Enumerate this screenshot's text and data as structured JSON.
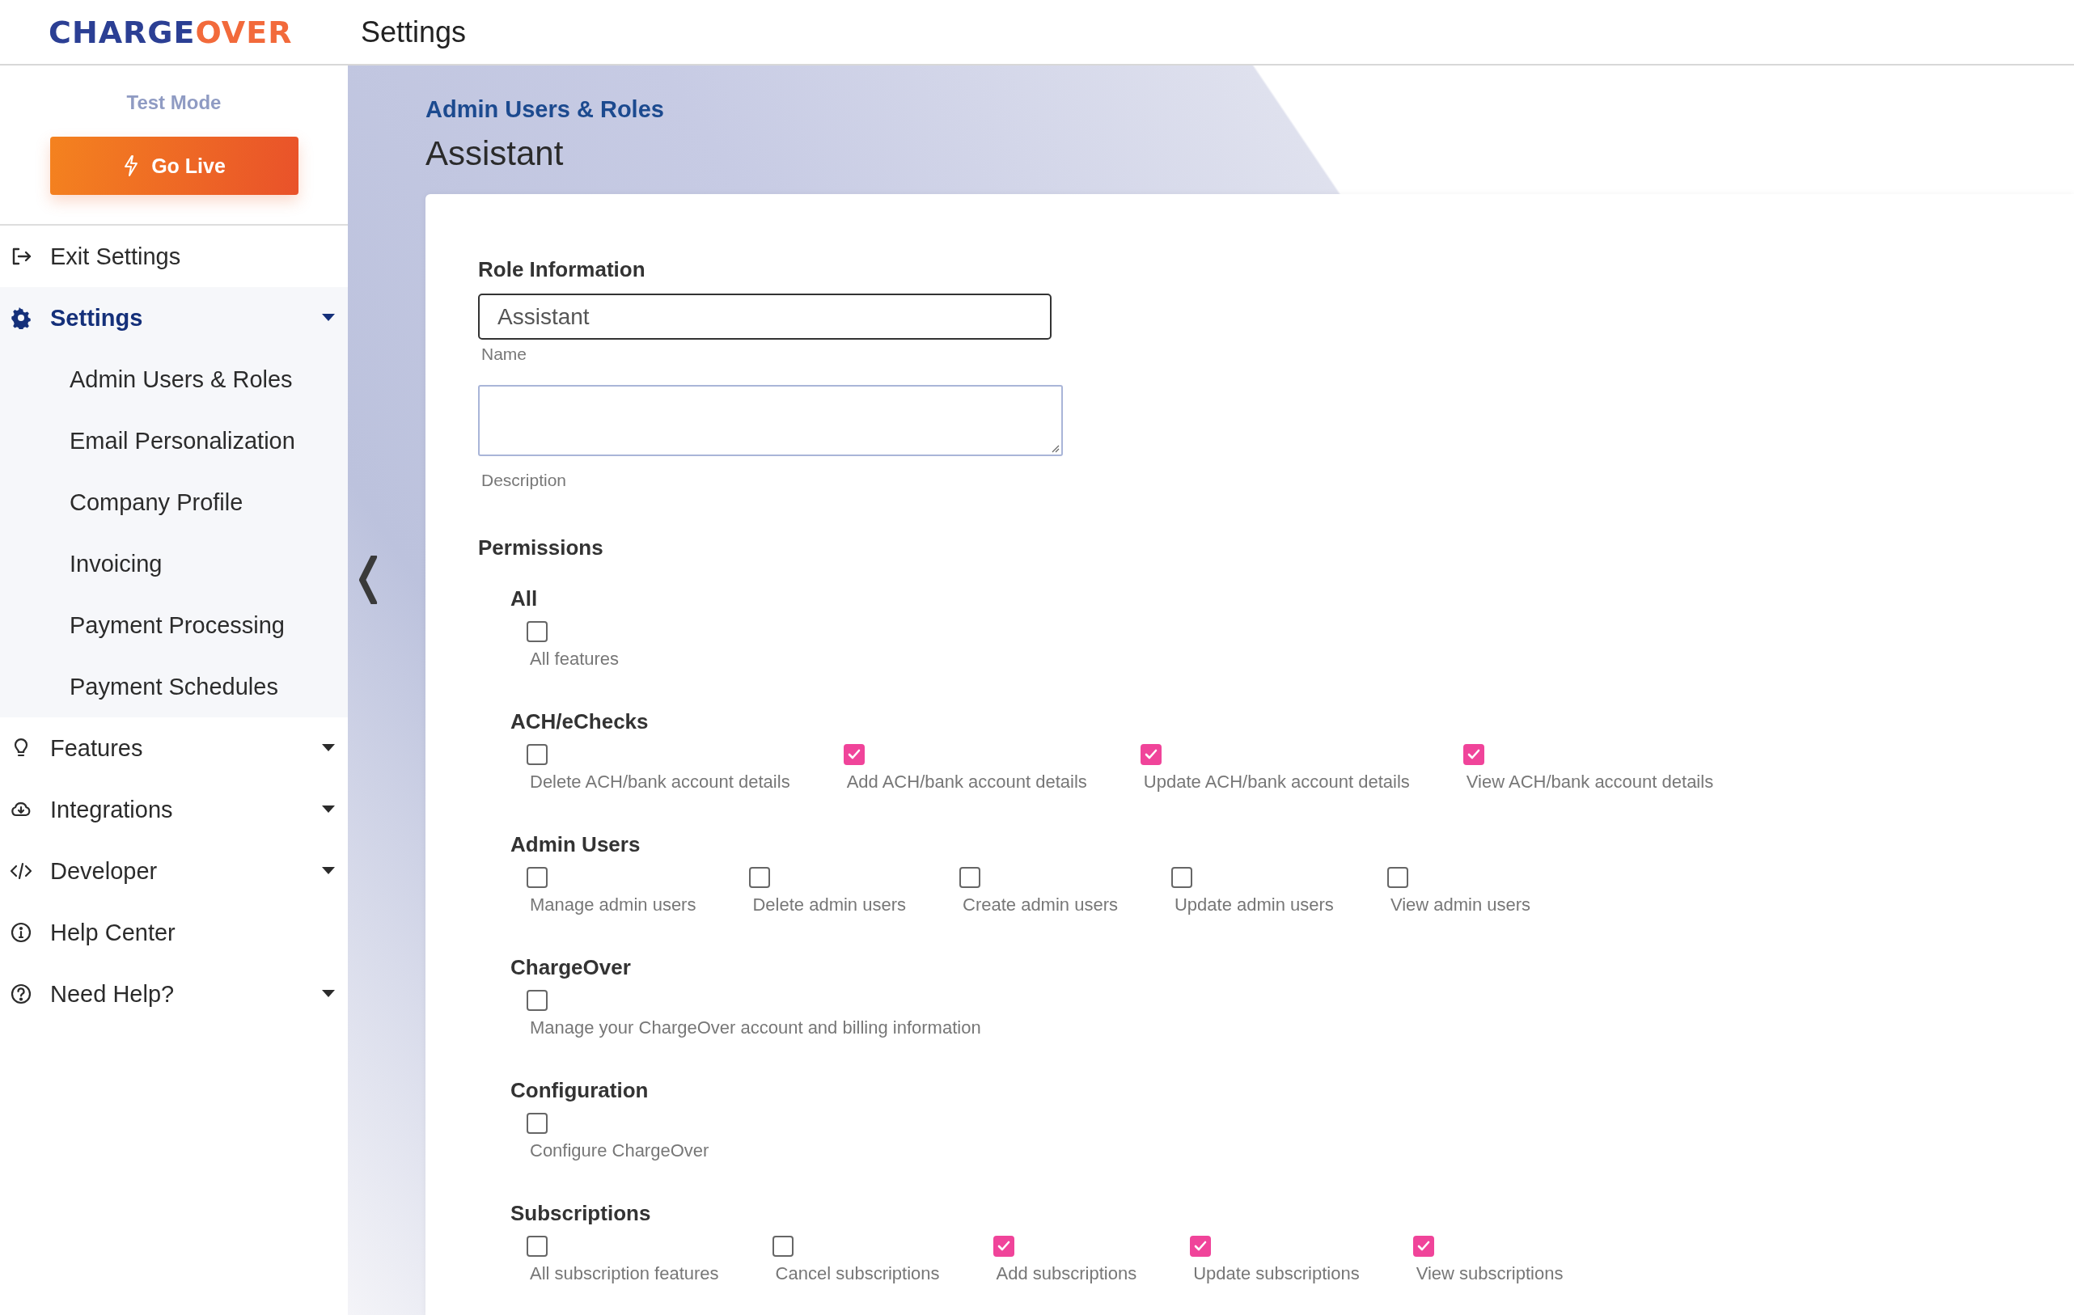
{
  "header": {
    "logo": [
      {
        "text": "CHARGE",
        "color": "#2b3f94"
      },
      {
        "text": "OVER",
        "color": "#f26a3b"
      }
    ],
    "title": "Settings"
  },
  "sidebar": {
    "mode": "Test Mode",
    "go_live": "Go Live",
    "items": [
      {
        "label": "Exit Settings",
        "expandable": false,
        "selected": false
      },
      {
        "label": "Settings",
        "expandable": true,
        "expanded": true,
        "selected": true,
        "children": [
          {
            "label": "Admin Users & Roles"
          },
          {
            "label": "Email Personalization"
          },
          {
            "label": "Company Profile"
          },
          {
            "label": "Invoicing"
          },
          {
            "label": "Payment Processing"
          },
          {
            "label": "Payment Schedules"
          }
        ]
      },
      {
        "label": "Features",
        "expandable": true,
        "expanded": false,
        "selected": false
      },
      {
        "label": "Integrations",
        "expandable": true,
        "expanded": false,
        "selected": false
      },
      {
        "label": "Developer",
        "expandable": true,
        "expanded": false,
        "selected": false
      },
      {
        "label": "Help Center",
        "expandable": false,
        "selected": false
      },
      {
        "label": "Need Help?",
        "expandable": true,
        "expanded": false,
        "selected": false
      }
    ]
  },
  "breadcrumb": "Admin Users & Roles",
  "page_title": "Assistant",
  "role": {
    "heading": "Role Information",
    "name_value": "Assistant",
    "name_label": "Name",
    "description_label": "Description"
  },
  "permissions": {
    "heading": "Permissions",
    "groups": [
      {
        "title": "All",
        "items": [
          {
            "label": "All features",
            "checked": false
          }
        ]
      },
      {
        "title": "ACH/eChecks",
        "items": [
          {
            "label": "Delete ACH/bank account details",
            "checked": false
          },
          {
            "label": "Add ACH/bank account details",
            "checked": true
          },
          {
            "label": "Update ACH/bank account details",
            "checked": true
          },
          {
            "label": "View ACH/bank account details",
            "checked": true
          }
        ]
      },
      {
        "title": "Admin Users",
        "items": [
          {
            "label": "Manage admin users",
            "checked": false
          },
          {
            "label": "Delete admin users",
            "checked": false
          },
          {
            "label": "Create admin users",
            "checked": false
          },
          {
            "label": "Update admin users",
            "checked": false
          },
          {
            "label": "View admin users",
            "checked": false
          }
        ]
      },
      {
        "title": "ChargeOver",
        "items": [
          {
            "label": "Manage your ChargeOver account and billing information",
            "checked": false
          }
        ]
      },
      {
        "title": "Configuration",
        "items": [
          {
            "label": "Configure ChargeOver",
            "checked": false
          }
        ]
      },
      {
        "title": "Subscriptions",
        "items": [
          {
            "label": "All subscription features",
            "checked": false
          },
          {
            "label": "Cancel subscriptions",
            "checked": false
          },
          {
            "label": "Add subscriptions",
            "checked": true
          },
          {
            "label": "Update subscriptions",
            "checked": true
          },
          {
            "label": "View subscriptions",
            "checked": true
          }
        ]
      }
    ]
  }
}
